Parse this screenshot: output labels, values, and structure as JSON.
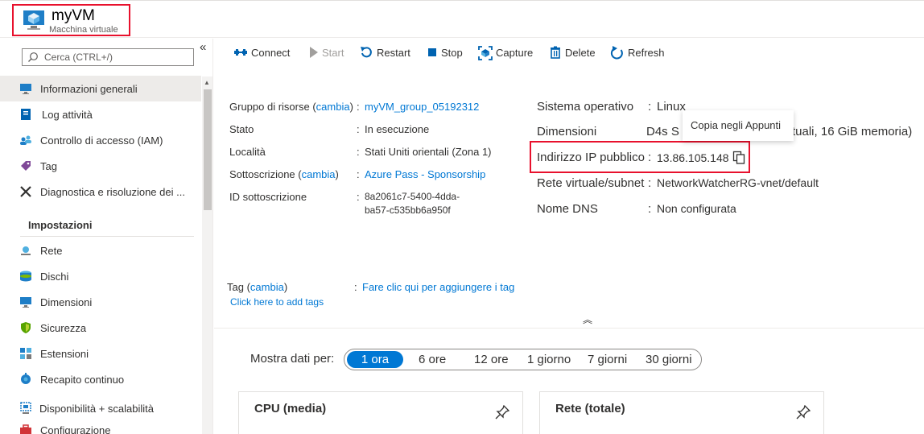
{
  "header": {
    "title": "myVM",
    "subtitle": "Macchina virtuale"
  },
  "sidebar": {
    "search_placeholder": "Cerca (CTRL+/)",
    "collapse": "«",
    "items": [
      {
        "label": "Informazioni generali",
        "icon": "overview-icon"
      },
      {
        "label": "Log attività",
        "icon": "activity-log-icon"
      },
      {
        "label": "Controllo di accesso (IAM)",
        "icon": "iam-icon"
      },
      {
        "label": "Tag",
        "icon": "tag-icon"
      },
      {
        "label": "Diagnostica e risoluzione dei ...",
        "icon": "diagnose-icon"
      }
    ],
    "section": "Impostazioni",
    "settings": [
      {
        "label": "Rete",
        "icon": "network-icon"
      },
      {
        "label": "Dischi",
        "icon": "disks-icon"
      },
      {
        "label": "Dimensioni",
        "icon": "size-icon"
      },
      {
        "label": "Sicurezza",
        "icon": "security-icon"
      },
      {
        "label": "Estensioni",
        "icon": "extensions-icon"
      },
      {
        "label": "Recapito continuo",
        "icon": "continuous-delivery-icon"
      },
      {
        "label": "Disponibilità + scalabilità",
        "icon": "availability-icon"
      },
      {
        "label": "Configurazione",
        "icon": "configuration-icon"
      }
    ]
  },
  "toolbar": {
    "connect": "Connect",
    "start": "Start",
    "restart": "Restart",
    "stop": "Stop",
    "capture": "Capture",
    "delete": "Delete",
    "refresh": "Refresh"
  },
  "essentials": {
    "resource_group_label": "Gruppo di risorse",
    "change": "cambia",
    "resource_group": "myVM_group_05192312",
    "status_label": "Stato",
    "status": "In esecuzione",
    "location_label": "Località",
    "location": "Stati Uniti orientali (Zona 1)",
    "subscription_label": "Sottoscrizione",
    "subscription": "Azure Pass - Sponsorship",
    "subscription_id_label": "ID sottoscrizione",
    "subscription_id_1": "8a2061c7-5400-4dda-",
    "subscription_id_2": "ba57-c535bb6a950f",
    "os_label": "Sistema operativo",
    "os": "Linux",
    "size_label": "Dimensioni",
    "size_prefix": "D4s S",
    "size_suffix": "tuali, 16 GiB memoria)",
    "ip_label": "Indirizzo IP pubblico",
    "ip": "13.86.105.148",
    "vnet_label": "Rete virtuale/subnet",
    "vnet": "NetworkWatcherRG-vnet/default",
    "dns_label": "Nome DNS",
    "dns": "Non configurata",
    "tooltip": "Copia negli Appunti",
    "tags_label": "Tag",
    "tags_value": "Fare clic qui per aggiungere i tag",
    "tags_hint": "Click here to add tags"
  },
  "range": {
    "label": "Mostra dati per:",
    "options": [
      "1 ora",
      "6 ore",
      "12 ore",
      "1 giorno",
      "7 giorni",
      "30 giorni"
    ],
    "selected": "1 ora"
  },
  "tiles": {
    "cpu": "CPU (media)",
    "network": "Rete (totale)"
  },
  "colors": {
    "accent": "#0078d4",
    "highlight": "#e8112d"
  }
}
